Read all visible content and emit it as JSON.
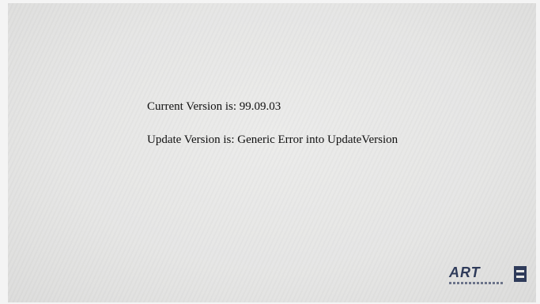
{
  "screen": {
    "current_version": "Current Version is: 99.09.03",
    "update_version": "Update Version is: Generic Error into UpdateVersion"
  },
  "branding": {
    "logo_name": "ART",
    "logo_icon": "brand-logo-icon"
  },
  "colors": {
    "screen_bg": "#e6e6e5",
    "text": "#111111",
    "brand": "#2f3b5a"
  }
}
